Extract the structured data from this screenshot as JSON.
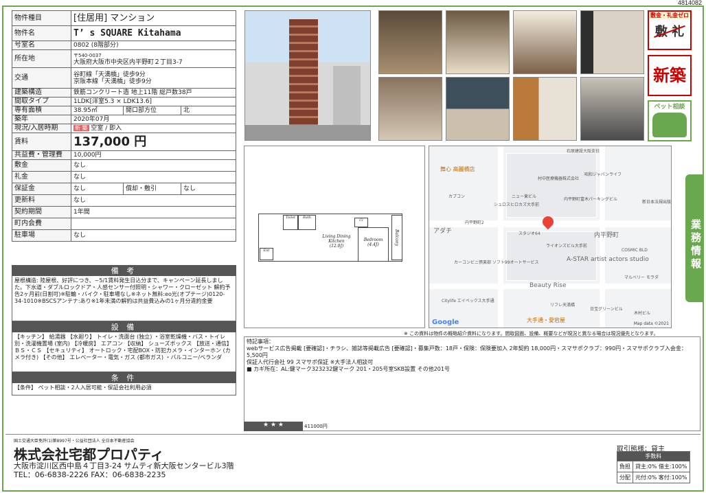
{
  "doc_no": "4814082",
  "property": {
    "type_label": "物件種目",
    "type_value": "[住居用] マンション",
    "name_label": "物件名",
    "name_value": "T’ s SQUARE Kitahama",
    "room_label": "号室名",
    "room_value": "0802 (8階部分)",
    "address_label": "所在地",
    "postal": "〒540-0037",
    "address": "大阪府大阪市中央区内平野町２丁目3-7",
    "transport_label": "交通",
    "transport1": "谷町線「天満橋」徒歩9分",
    "transport2": "京阪本線「天満橋」徒歩9分",
    "structure_label": "建築構造",
    "structure_value": "鉄筋コンクリート造 地上11階 総戸数38戸",
    "layout_label": "間取タイプ",
    "layout_value": "1LDK[洋室5.3 × LDK13.6]",
    "area_label": "専有面積",
    "area_value": "38.95㎡",
    "direction_label": "開口部方位",
    "direction_value": "北",
    "built_label": "築年",
    "built_value": "2020年07月",
    "status_label": "現況/入居時期",
    "status_badge": "新 築",
    "status_value": "空室 / 即入",
    "rent_label": "賃料",
    "rent_value": "137,000 円",
    "fee_label": "共益費・管理費",
    "fee_value": "10,000円",
    "deposit_label": "敷金",
    "deposit_value": "なし",
    "key_money_label": "礼金",
    "key_money_value": "なし",
    "guarantee_label": "保証金",
    "guarantee_value": "なし",
    "amort_label": "償却・敷引",
    "amort_value": "なし",
    "renewal_label": "更新料",
    "renewal_value": "なし",
    "contract_label": "契約期間",
    "contract_value": "1年間",
    "town_fee_label": "町内会費",
    "town_fee_value": "",
    "parking_label": "駐車場",
    "parking_value": "なし"
  },
  "remarks": {
    "title": "備 考",
    "text": "屋根構造: 陸屋根、好評につき、~5/1賃料発生日込分まで、キャンペーン延長しました。下水道・ダブルロックドア・人感センサー付照明・シャワー・クローゼット 解約予告2ヶ月前(日割可)※駐輪・バイク・駐車場なし※ネット無料:eo光(オプテージ)0120-34-1010※BSCSアンテナ:あり※1年未満の解約は共益費込みの1ヶ月分違約金要"
  },
  "equipment": {
    "title": "設 備",
    "text": "【キッチン】 給湯器 【水廻り】 トイレ・洗面台 (独立) ・浴室乾燥機・バス・トイレ別・洗濯機置場 (室内) 【冷暖房】 エアコン 【収納】 シューズボックス 【放送・通信】 ＢＳ・ＣＳ 【セキュリティ】 オートロック・宅配BOX・防犯カメラ・インターホン (カメラ付き) 【その他】 エレベーター・電気・ガス (都市ガス) ・バルコニー/ベランダ"
  },
  "conditions": {
    "title": "条 件",
    "text": "【条件】 ペット相談・2人入居可能・保証会社利用必須"
  },
  "icons": {
    "no_deposit_label": "敷金・礼金ゼロ",
    "no_deposit_big": "敷 礼",
    "new_build": "新築",
    "pet_label": "ペット相談"
  },
  "side_tab": "業務情報",
  "floorplan": {
    "ldk_label": "Living Dining Kitchen",
    "ldk_size": "(12.0J)",
    "bedroom_label": "Bedroom",
    "bedroom_size": "(4.4J)",
    "balcony": "Balcony",
    "entrance": "Ent",
    "closet": "Cl",
    "toilet": "Toilet",
    "bath": "Bath"
  },
  "map": {
    "labels": [
      "石原建設大阪支社",
      "昭和ジャパンライフ",
      "舞心 高麗橋店",
      "村中医療機器株式会社",
      "ニュー東ビル",
      "シュロスヒロカズ大手前",
      "内平野町富木パーキングビル",
      "新日本法規出版大阪支社",
      "カプコン",
      "内平野町2",
      "スタジオ64",
      "ライオンズビル大手前",
      "COSMIC BLD",
      "アダチ",
      "カーコンビニ倶楽部 ソフト99オートサービス",
      "A-STAR artist actors studio",
      "マルベリー モラダ",
      "Beauty Rise",
      "Citylife エイペックス大手通",
      "リフレ天満橋",
      "日宝グリーンビル",
      "木村ビル",
      "大手通・愛宕屋"
    ],
    "street": "内平野町",
    "google": "Google",
    "data": "Map data ©2021"
  },
  "note": "※ この資料は物件の概略紹介資料になります。間取図面、設備、概要などが現況と異なる場合は現況優先となります。",
  "special": {
    "title": "特記事項：",
    "line1": "webサービス広告掲載 [要確認]・チラシ、雑誌等掲載広告 [要確認]・募集戸数：18戸・保険：保険要加入 2年契約 18,000円・スマサポクラブ：990円・スマサポクラブ入会金：5,500円",
    "line2": "保証人代行会社 99 スマサポ保証 ※大手法人相談可",
    "line3": "■ カギ所在：AL:鍵マーク323232鍵マーク 201・205号室SKB設置 その他201号"
  },
  "stars": "★ ★ ★",
  "ad_code": "411000円",
  "company": {
    "license": "国土交通大臣免許(1)第8997号・公益社団法人 全日本不動産協会",
    "name": "株式会社宅都プロパティ",
    "address": "大阪市淀川区西中島４丁目3-24 サムティ新大阪センタービル3階",
    "tel": "TEL：06-6838-2226 FAX：06-6838-2235"
  },
  "terms": {
    "title": "取引態様：貸主",
    "fee_header": "手数料",
    "row1_label": "負担",
    "row1_value": "貸主:0% 借主:100%",
    "row2_label": "分配",
    "row2_value": "元付:0% 客付:100%"
  }
}
